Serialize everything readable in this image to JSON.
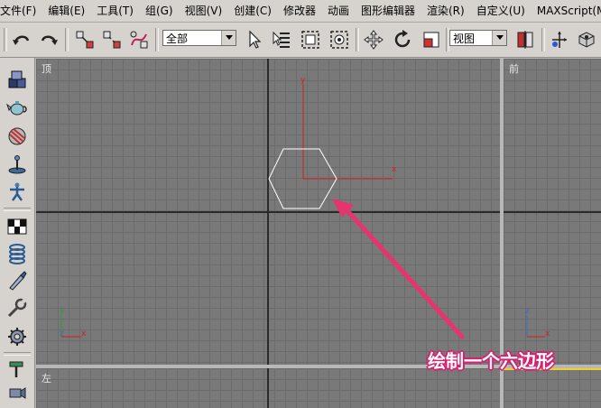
{
  "menu": [
    "文件(F)",
    "编辑(E)",
    "工具(T)",
    "组(G)",
    "视图(V)",
    "创建(C)",
    "修改器",
    "动画",
    "图形编辑器",
    "渲染(R)",
    "自定义(U)",
    "MAXScript(M)"
  ],
  "toolbar": {
    "selection_filter": "全部",
    "reference_coord": "视图"
  },
  "viewports": {
    "top": {
      "label": "顶"
    },
    "front": {
      "label": "前"
    },
    "left": {
      "label": "左"
    }
  },
  "axis_labels": {
    "x": "x",
    "y": "y",
    "z": "z"
  },
  "annotation": "绘制一个六边形",
  "colors": {
    "ui_bg": "#d6d3ce",
    "viewport_bg": "#797979",
    "grid_line": "#6b6b6b",
    "hexagon": "#ffffff",
    "gizmo_red": "#d02020",
    "annotation_pink": "#e8336f"
  },
  "icons": {
    "toolbar": [
      "undo-icon",
      "redo-icon",
      "link-icon",
      "unlink-icon",
      "bind-space-warp-icon",
      "select-object-icon",
      "select-by-name-icon",
      "rectangular-selection-icon",
      "window-crossing-icon",
      "move-icon",
      "rotate-icon",
      "scale-icon",
      "use-pivot-icon",
      "mirror-icon",
      "render-icon"
    ],
    "side": [
      "box-icon",
      "teapot-icon",
      "sphere-icon",
      "plane-icon",
      "bone-icon",
      "checker-icon",
      "spring-icon",
      "knife-icon",
      "wrench-icon",
      "gear-icon",
      "hammer-icon",
      "camera-icon"
    ]
  }
}
